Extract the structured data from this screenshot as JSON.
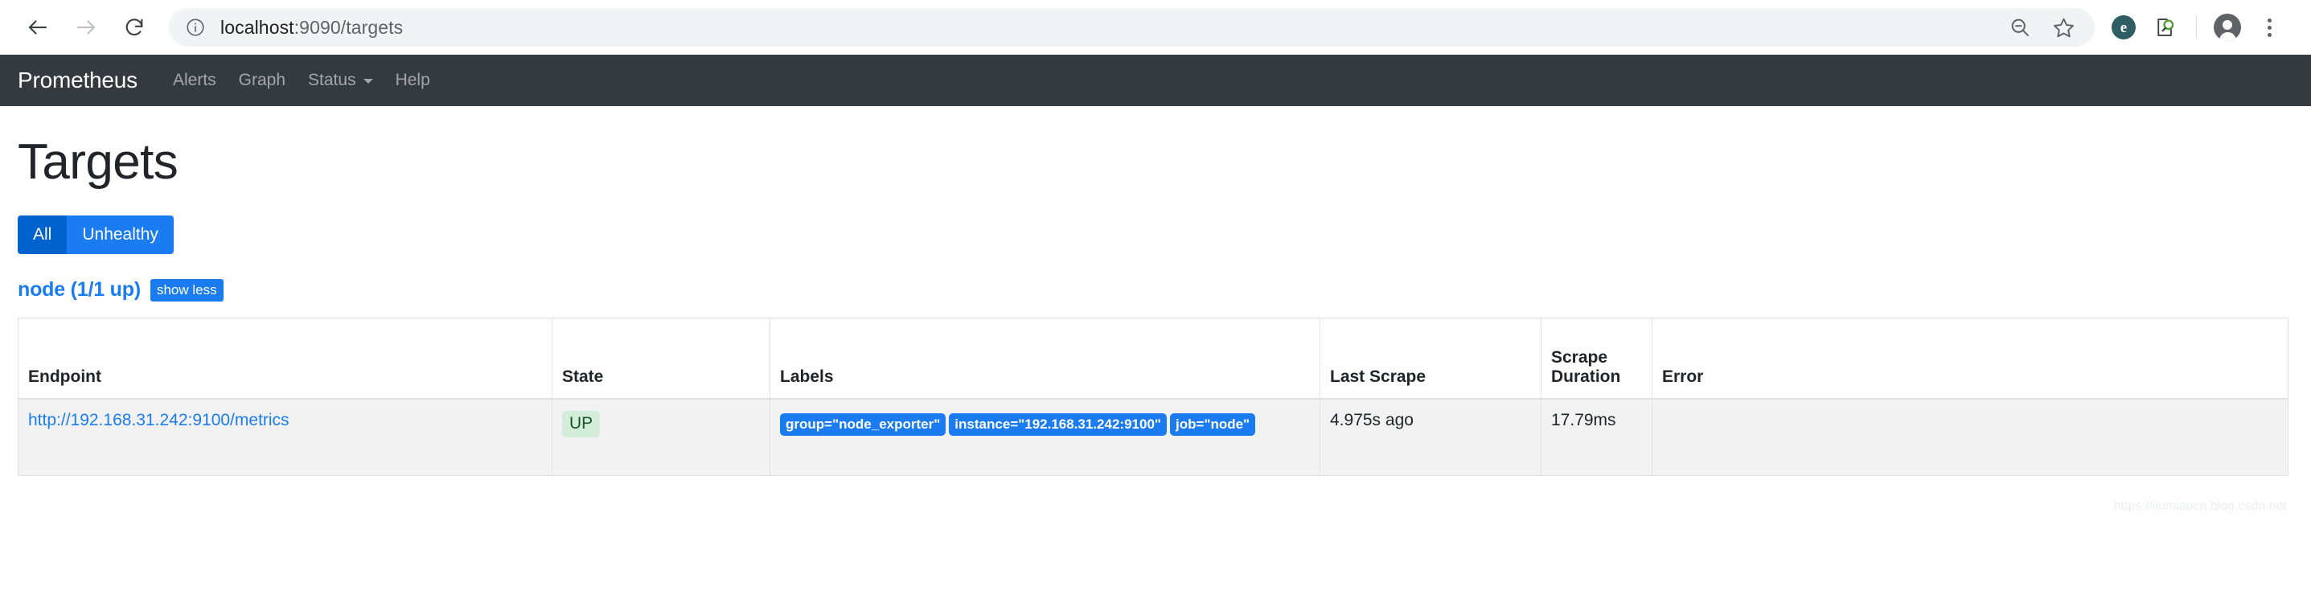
{
  "browser": {
    "back_icon": "back-arrow-icon",
    "forward_icon": "forward-arrow-icon",
    "reload_icon": "reload-icon",
    "site_info_icon": "info-circle-icon",
    "url_host": "localhost",
    "url_path": ":9090/targets",
    "zoom_out_icon": "zoom-out-magnifier-icon",
    "bookmark_icon": "star-outline-icon",
    "extension_one_icon": "extension-circle-icon",
    "extension_one_glyph": "e",
    "extension_two_icon": "search-document-extension-icon",
    "profile_icon": "profile-avatar-icon",
    "menu_icon": "three-dot-menu-icon"
  },
  "nav": {
    "brand": "Prometheus",
    "links": [
      {
        "label": "Alerts",
        "caret": false
      },
      {
        "label": "Graph",
        "caret": false
      },
      {
        "label": "Status",
        "caret": true
      },
      {
        "label": "Help",
        "caret": false
      }
    ]
  },
  "page": {
    "title": "Targets",
    "filters": [
      {
        "label": "All",
        "active": true
      },
      {
        "label": "Unhealthy",
        "active": false
      }
    ],
    "group": {
      "title": "node (1/1 up)",
      "toggle_label": "show less"
    },
    "watermark": "https://liumiaocn.blog.csdn.net"
  },
  "table": {
    "headers": [
      "Endpoint",
      "State",
      "Labels",
      "Last Scrape",
      "Scrape Duration",
      "Error"
    ],
    "rows": [
      {
        "endpoint": "http://192.168.31.242:9100/metrics",
        "state": "UP",
        "labels": [
          "group=\"node_exporter\"",
          "instance=\"192.168.31.242:9100\"",
          "job=\"node\""
        ],
        "last_scrape": "4.975s ago",
        "scrape_duration": "17.79ms",
        "error": ""
      }
    ]
  },
  "colors": {
    "navbar": "#343a40",
    "primary_blue": "#1a7cf0",
    "active_blue": "#0062cc",
    "up_bg": "#d4edda",
    "up_text": "#155724",
    "row_stripe": "#f2f2f2"
  }
}
